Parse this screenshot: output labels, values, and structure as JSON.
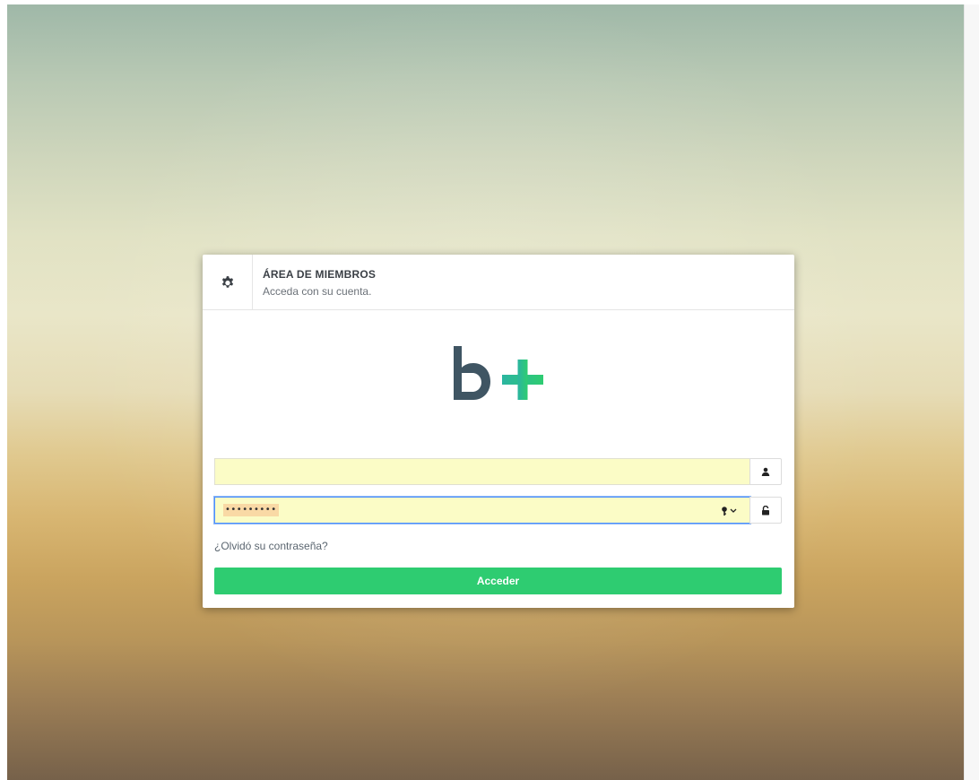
{
  "header": {
    "title": "ÁREA DE MIEMBROS",
    "subtitle": "Acceda con su cuenta."
  },
  "logo": {
    "letter": "b",
    "symbol": "+",
    "letter_color": "#3f5563",
    "symbol_color_start": "#2bb5a0",
    "symbol_color_end": "#2ecc71"
  },
  "form": {
    "username": {
      "value": "",
      "placeholder": "",
      "icon": "user-icon"
    },
    "password": {
      "masked_value": "•••••••••",
      "icon": "unlock-icon",
      "autofill_icon": "key-icon"
    },
    "forgot_link": "¿Olvidó su contraseña?",
    "submit_label": "Acceder"
  },
  "colors": {
    "accent": "#2ecc71",
    "autofill_bg": "#fbfcc6",
    "focus_border": "#4d90fe"
  }
}
